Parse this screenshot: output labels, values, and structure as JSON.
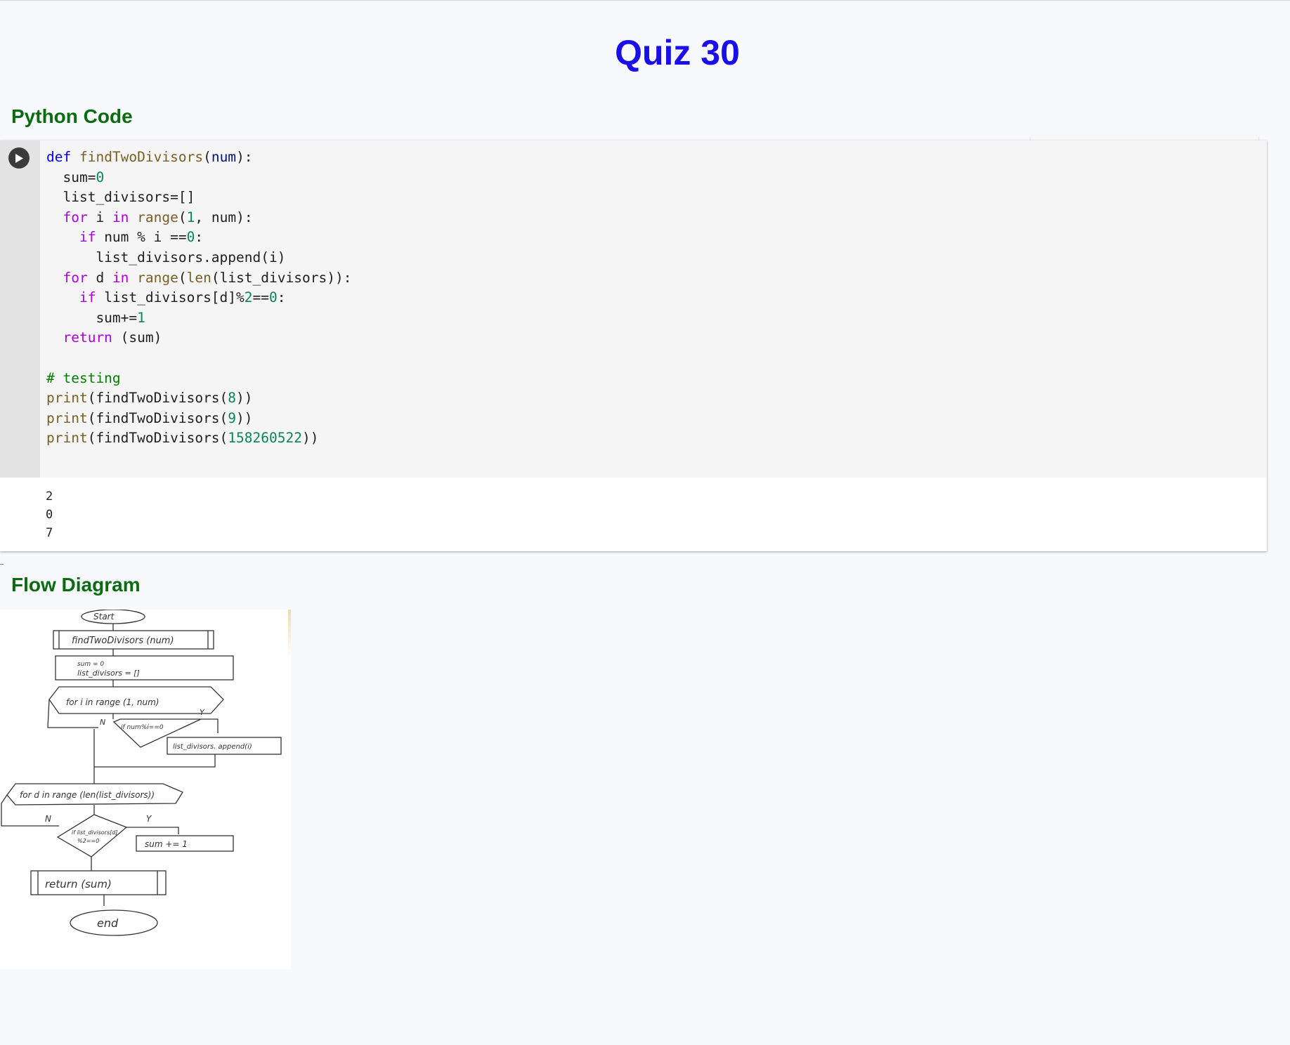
{
  "page": {
    "title": "Quiz 30"
  },
  "sections": {
    "code_heading": "Python Code",
    "diagram_heading": "Flow Diagram"
  },
  "code_cell": {
    "run_icon": "play-icon",
    "lines": [
      [
        [
          "kw",
          "def "
        ],
        [
          "fn",
          "findTwoDivisors"
        ],
        [
          "p",
          "("
        ],
        [
          "var",
          "num"
        ],
        [
          "p",
          "):"
        ]
      ],
      [
        [
          "p",
          "  sum="
        ],
        [
          "num",
          "0"
        ]
      ],
      [
        [
          "p",
          "  list_divisors=[]"
        ]
      ],
      [
        [
          "ctl",
          "  for "
        ],
        [
          "p",
          "i "
        ],
        [
          "ctl",
          "in "
        ],
        [
          "bi",
          "range"
        ],
        [
          "p",
          "("
        ],
        [
          "num",
          "1"
        ],
        [
          "p",
          ", num):"
        ]
      ],
      [
        [
          "ctl",
          "    if "
        ],
        [
          "p",
          "num % i =="
        ],
        [
          "num",
          "0"
        ],
        [
          "p",
          ":"
        ]
      ],
      [
        [
          "p",
          "      list_divisors.append(i)"
        ]
      ],
      [
        [
          "ctl",
          "  for "
        ],
        [
          "p",
          "d "
        ],
        [
          "ctl",
          "in "
        ],
        [
          "bi",
          "range"
        ],
        [
          "p",
          "("
        ],
        [
          "bi",
          "len"
        ],
        [
          "p",
          "(list_divisors)):"
        ]
      ],
      [
        [
          "ctl",
          "    if "
        ],
        [
          "p",
          "list_divisors[d]%"
        ],
        [
          "num",
          "2"
        ],
        [
          "p",
          "=="
        ],
        [
          "num",
          "0"
        ],
        [
          "p",
          ":"
        ]
      ],
      [
        [
          "p",
          "      sum+="
        ],
        [
          "num",
          "1"
        ]
      ],
      [
        [
          "ctl",
          "  return "
        ],
        [
          "p",
          "(sum)"
        ]
      ],
      [
        [
          "p",
          ""
        ]
      ],
      [
        [
          "cm",
          "# testing"
        ]
      ],
      [
        [
          "bi",
          "print"
        ],
        [
          "p",
          "(findTwoDivisors("
        ],
        [
          "num",
          "8"
        ],
        [
          "p",
          "))"
        ]
      ],
      [
        [
          "bi",
          "print"
        ],
        [
          "p",
          "(findTwoDivisors("
        ],
        [
          "num",
          "9"
        ],
        [
          "p",
          "))"
        ]
      ],
      [
        [
          "bi",
          "print"
        ],
        [
          "p",
          "(findTwoDivisors("
        ],
        [
          "num",
          "158260522"
        ],
        [
          "p",
          "))"
        ]
      ]
    ],
    "output": [
      "2",
      "0",
      "7"
    ]
  },
  "flow_diagram": {
    "start": "Start",
    "func": "findTwoDivisors (num)",
    "init1": "sum = 0",
    "init2": "list_divisors = []",
    "loop1": "for i in range (1, num)",
    "cond1": "if num%i==0",
    "no1": "N",
    "yes1": "Y",
    "act1": "list_divisors. append(i)",
    "loop2": "for d in range (len(list_divisors))",
    "cond2a": "if list_divisors[d]",
    "cond2b": "%2==0",
    "no2": "N",
    "yes2": "Y",
    "act2": "sum += 1",
    "ret": "return (sum)",
    "end": "end"
  },
  "colors": {
    "title": "#1a0fe8",
    "heading": "#0b6b10",
    "kw": "#0000ff",
    "ctl": "#af00db",
    "fn": "#795e26",
    "var": "#001080",
    "num": "#098658",
    "bi": "#795e26",
    "cm": "#008000",
    "p": "#1f1f1f"
  }
}
